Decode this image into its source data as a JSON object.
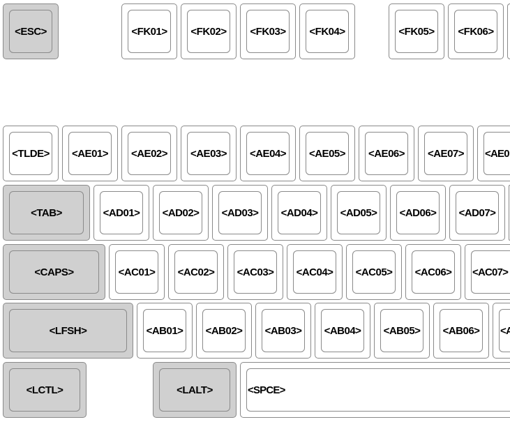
{
  "rows": {
    "function": [
      {
        "label": "<ESC>",
        "mod": true
      },
      {
        "label": "<FK01>"
      },
      {
        "label": "<FK02>"
      },
      {
        "label": "<FK03>"
      },
      {
        "label": "<FK04>"
      },
      {
        "label": "<FK05>"
      },
      {
        "label": "<FK06>"
      },
      {
        "label": ""
      }
    ],
    "numbers": [
      {
        "label": "<TLDE>"
      },
      {
        "label": "<AE01>"
      },
      {
        "label": "<AE02>"
      },
      {
        "label": "<AE03>"
      },
      {
        "label": "<AE04>"
      },
      {
        "label": "<AE05>"
      },
      {
        "label": "<AE06>"
      },
      {
        "label": "<AE07>"
      },
      {
        "label": "<AE0"
      }
    ],
    "top": [
      {
        "label": "<TAB>",
        "mod": true
      },
      {
        "label": "<AD01>"
      },
      {
        "label": "<AD02>"
      },
      {
        "label": "<AD03>"
      },
      {
        "label": "<AD04>"
      },
      {
        "label": "<AD05>"
      },
      {
        "label": "<AD06>"
      },
      {
        "label": "<AD07>"
      },
      {
        "label": ""
      }
    ],
    "home": [
      {
        "label": "<CAPS>",
        "mod": true
      },
      {
        "label": "<AC01>"
      },
      {
        "label": "<AC02>"
      },
      {
        "label": "<AC03>"
      },
      {
        "label": "<AC04>"
      },
      {
        "label": "<AC05>"
      },
      {
        "label": "<AC06>"
      },
      {
        "label": "<AC07>"
      }
    ],
    "bottom": [
      {
        "label": "<LFSH>",
        "mod": true
      },
      {
        "label": "<AB01>"
      },
      {
        "label": "<AB02>"
      },
      {
        "label": "<AB03>"
      },
      {
        "label": "<AB04>"
      },
      {
        "label": "<AB05>"
      },
      {
        "label": "<AB06>"
      },
      {
        "label": "<A"
      }
    ],
    "space": [
      {
        "label": "<LCTL>",
        "mod": true
      },
      {
        "label": "<LALT>",
        "mod": true
      },
      {
        "label": "<SPCE>"
      }
    ]
  }
}
